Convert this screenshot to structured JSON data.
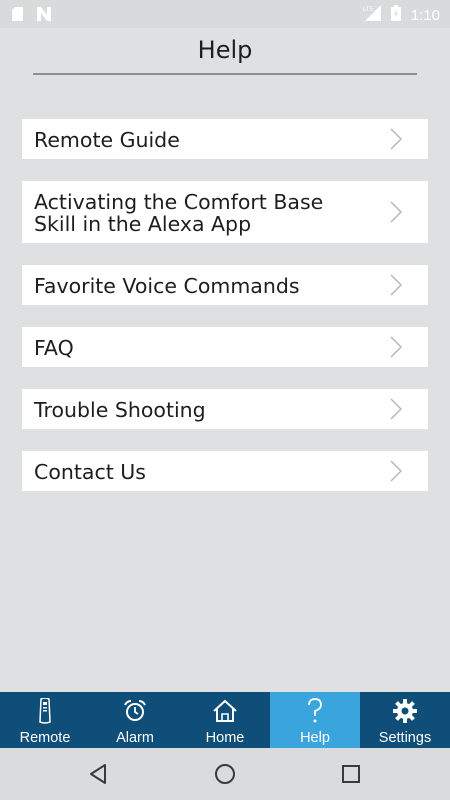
{
  "status_bar": {
    "time": "1:10",
    "left_icons": [
      "sd-card-icon",
      "notification-n-icon"
    ],
    "right_icons": [
      "lte-signal-icon",
      "battery-icon"
    ]
  },
  "header": {
    "title": "Help"
  },
  "menu": {
    "items": [
      {
        "label": "Remote Guide"
      },
      {
        "label": "Activating the Comfort Base Skill in the Alexa App"
      },
      {
        "label": "Favorite Voice Commands"
      },
      {
        "label": "FAQ"
      },
      {
        "label": "Trouble Shooting"
      },
      {
        "label": "Contact Us"
      }
    ]
  },
  "tab_bar": {
    "active_tab": "Help",
    "tabs": [
      {
        "label": "Remote",
        "icon": "remote-icon"
      },
      {
        "label": "Alarm",
        "icon": "alarm-clock-icon"
      },
      {
        "label": "Home",
        "icon": "home-icon"
      },
      {
        "label": "Help",
        "icon": "question-mark-icon"
      },
      {
        "label": "Settings",
        "icon": "gear-icon"
      }
    ]
  },
  "nav_bar": {
    "buttons": [
      "back-icon",
      "home-circle-icon",
      "recents-square-icon"
    ]
  },
  "colors": {
    "background": "#dfe0e2",
    "tab_bar": "#0f4e78",
    "tab_active": "#3aa5dd",
    "menu_item_bg": "#ffffff",
    "title_rule": "#8a8e96"
  }
}
